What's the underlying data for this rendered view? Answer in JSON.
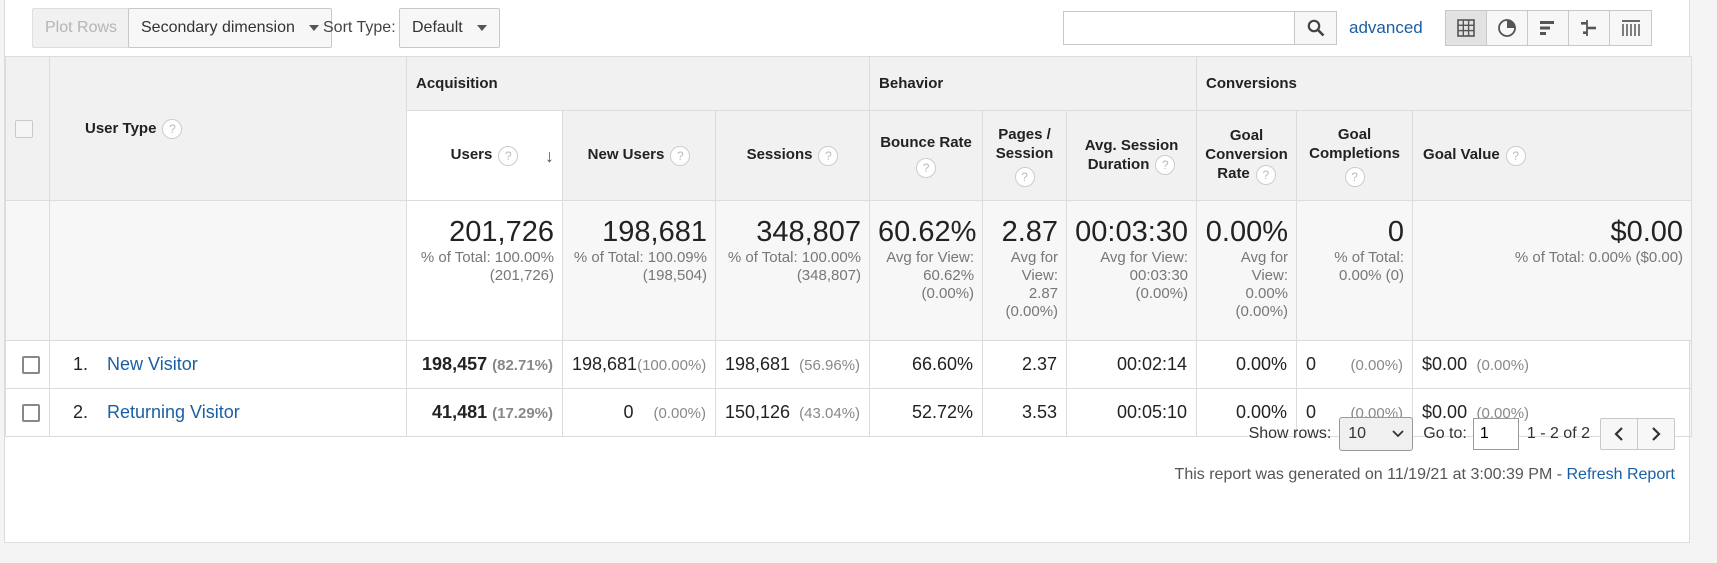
{
  "toolbar": {
    "plot_rows": "Plot Rows",
    "secondary_dimension": "Secondary dimension",
    "sort_type_label": "Sort Type:",
    "sort_type_value": "Default",
    "search_placeholder": "",
    "advanced": "advanced",
    "view_icons": [
      "table-view-icon",
      "pie-view-icon",
      "performance-view-icon",
      "comparison-view-icon",
      "pivot-view-icon"
    ]
  },
  "groups": {
    "acquisition": "Acquisition",
    "behavior": "Behavior",
    "conversions": "Conversions"
  },
  "headers": {
    "dimension": "User Type",
    "users": "Users",
    "new_users": "New Users",
    "sessions": "Sessions",
    "bounce_rate": "Bounce Rate",
    "pages_session": "Pages / Session",
    "avg_duration": "Avg. Session Duration",
    "goal_conv_rate": "Goal Conversion Rate",
    "goal_completions": "Goal Completions",
    "goal_value": "Goal Value"
  },
  "totals": {
    "users": {
      "value": "201,726",
      "sub": "% of Total: 100.00% (201,726)"
    },
    "new_users": {
      "value": "198,681",
      "sub": "% of Total: 100.09% (198,504)"
    },
    "sessions": {
      "value": "348,807",
      "sub": "% of Total: 100.00% (348,807)"
    },
    "bounce_rate": {
      "value": "60.62%",
      "sub": "Avg for View: 60.62% (0.00%)"
    },
    "pages_session": {
      "value": "2.87",
      "sub": "Avg for View: 2.87 (0.00%)"
    },
    "avg_duration": {
      "value": "00:03:30",
      "sub": "Avg for View: 00:03:30 (0.00%)"
    },
    "goal_conv_rate": {
      "value": "0.00%",
      "sub": "Avg for View: 0.00% (0.00%)"
    },
    "goal_completions": {
      "value": "0",
      "sub": "% of Total: 0.00% (0)"
    },
    "goal_value": {
      "value": "$0.00",
      "sub": "% of Total: 0.00% ($0.00)"
    }
  },
  "rows": [
    {
      "num": "1.",
      "dimension": "New Visitor",
      "users": "198,457",
      "users_pct": "(82.71%)",
      "new_users": "198,681",
      "new_users_pct": "(100.00%)",
      "sessions": "198,681",
      "sessions_pct": "(56.96%)",
      "bounce_rate": "66.60%",
      "pages_session": "2.37",
      "avg_duration": "00:02:14",
      "goal_conv_rate": "0.00%",
      "goal_completions": "0",
      "goal_completions_pct": "(0.00%)",
      "goal_value": "$0.00",
      "goal_value_pct": "(0.00%)"
    },
    {
      "num": "2.",
      "dimension": "Returning Visitor",
      "users": "41,481",
      "users_pct": "(17.29%)",
      "new_users": "0",
      "new_users_pct": "(0.00%)",
      "sessions": "150,126",
      "sessions_pct": "(43.04%)",
      "bounce_rate": "52.72%",
      "pages_session": "3.53",
      "avg_duration": "00:05:10",
      "goal_conv_rate": "0.00%",
      "goal_completions": "0",
      "goal_completions_pct": "(0.00%)",
      "goal_value": "$0.00",
      "goal_value_pct": "(0.00%)"
    }
  ],
  "footer": {
    "show_rows_label": "Show rows:",
    "show_rows_value": "10",
    "goto_label": "Go to:",
    "goto_value": "1",
    "range": "1 - 2 of 2",
    "generated": "This report was generated on 11/19/21 at 3:00:39 PM -",
    "refresh": "Refresh Report"
  },
  "colors": {
    "link": "#1a5fa5",
    "header_bg": "#f1f1f1"
  }
}
